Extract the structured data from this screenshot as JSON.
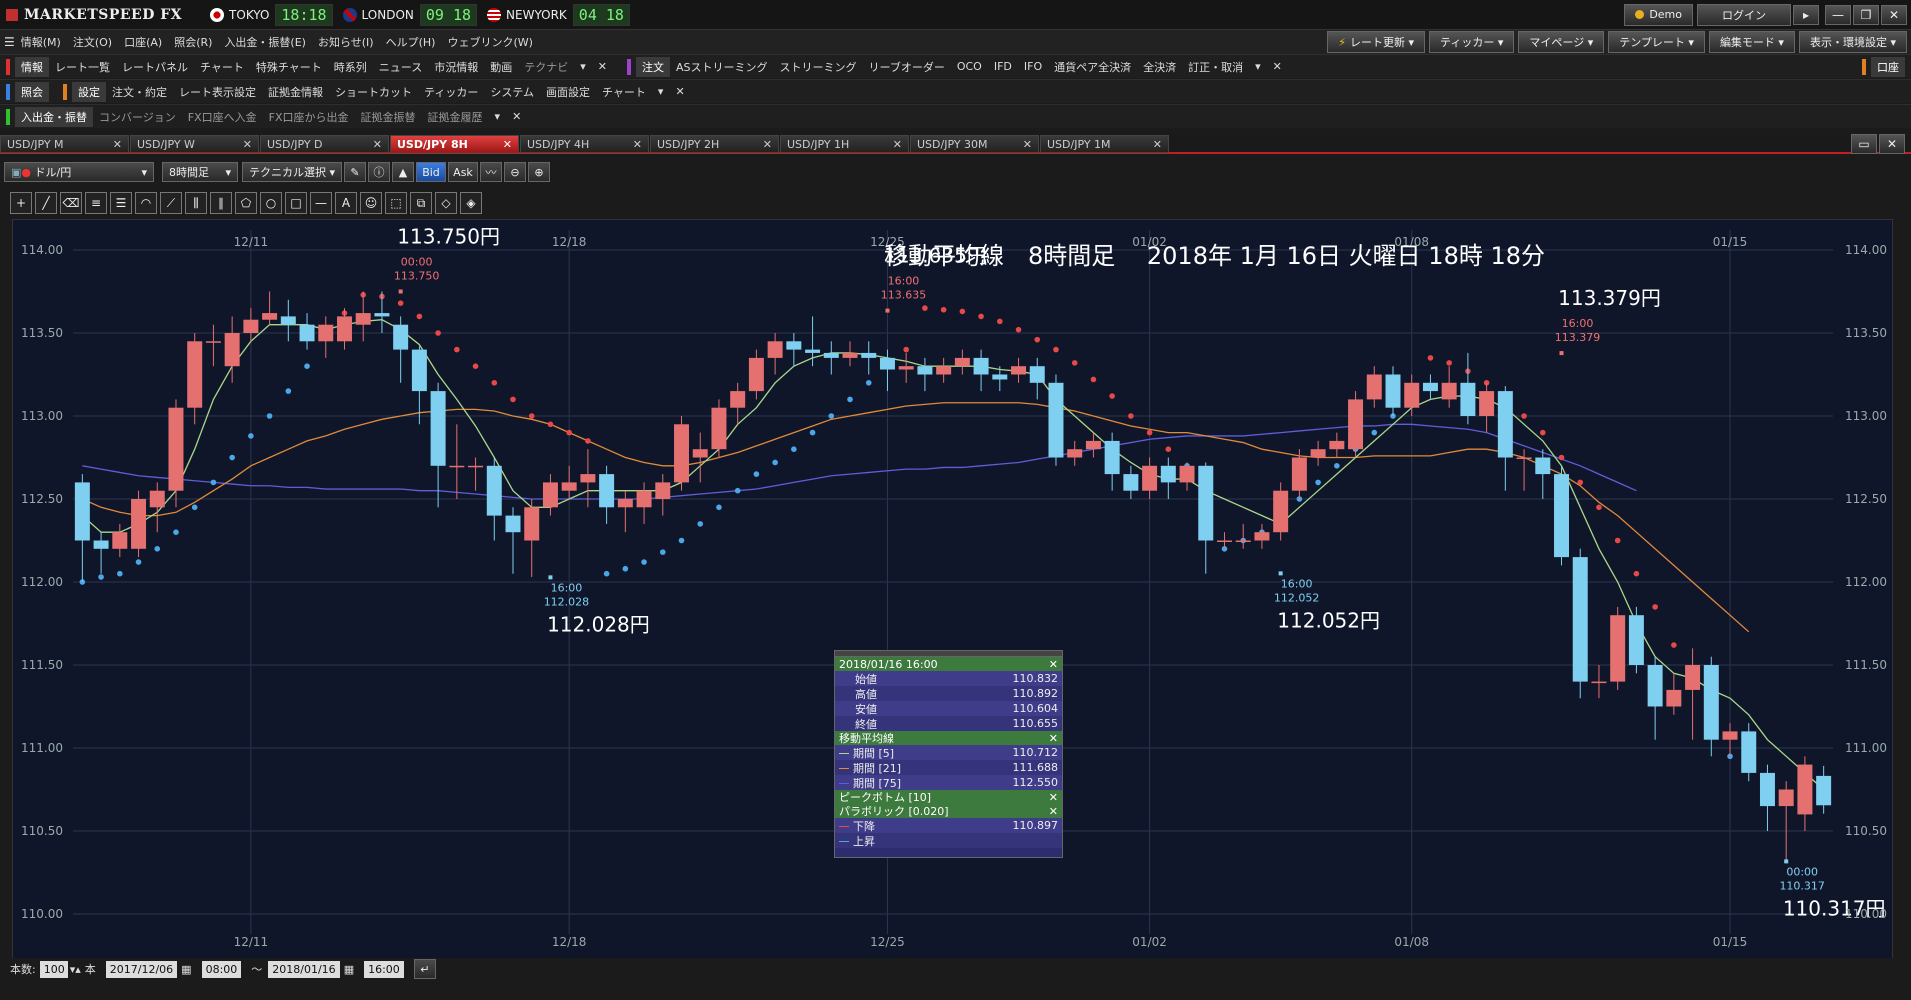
{
  "app": {
    "name": "MARKETSPEED FX",
    "cities": [
      {
        "name": "TOKYO",
        "time": "18:18",
        "flag": "jp"
      },
      {
        "name": "LONDON",
        "time": "09 18",
        "flag": "gb"
      },
      {
        "name": "NEWYORK",
        "time": "04 18",
        "flag": "us"
      }
    ],
    "demo": "Demo",
    "login": "ログイン"
  },
  "menu": [
    "情報(M)",
    "注文(O)",
    "口座(A)",
    "照会(R)",
    "入出金・振替(E)",
    "お知らせ(I)",
    "ヘルプ(H)",
    "ウェブリンク(W)"
  ],
  "menu_right": [
    "レート更新",
    "ティッカー",
    "マイページ",
    "テンプレート",
    "編集モード",
    "表示・環境設定"
  ],
  "toolbar1": {
    "info_header": "情報",
    "info_items": [
      "レート一覧",
      "レートパネル",
      "チャート",
      "特殊チャート",
      "時系列",
      "ニュース",
      "市況情報",
      "動画"
    ],
    "info_dim": "テクナビ",
    "order_header": "注文",
    "order_items": [
      "ASストリーミング",
      "ストリーミング",
      "リーブオーダー",
      "OCO",
      "IFD",
      "IFO",
      "通貨ペア全決済",
      "全決済",
      "訂正・取消"
    ],
    "account_btn": "口座"
  },
  "toolbar2": {
    "inquiry_header": "照会",
    "settings_header": "設定",
    "settings_items": [
      "注文・約定",
      "レート表示設定",
      "証拠金情報",
      "ショートカット",
      "ティッカー",
      "システム",
      "画面設定",
      "チャート"
    ]
  },
  "toolbar3": {
    "deposit_header": "入出金・振替",
    "deposit_items": [
      "コンバージョン",
      "FX口座へ入金",
      "FX口座から出金",
      "証拠金振替",
      "証拠金履歴"
    ]
  },
  "tabs": [
    {
      "label": "USD/JPY M",
      "active": false
    },
    {
      "label": "USD/JPY W",
      "active": false
    },
    {
      "label": "USD/JPY D",
      "active": false
    },
    {
      "label": "USD/JPY 8H",
      "active": true
    },
    {
      "label": "USD/JPY 4H",
      "active": false
    },
    {
      "label": "USD/JPY 2H",
      "active": false
    },
    {
      "label": "USD/JPY 1H",
      "active": false
    },
    {
      "label": "USD/JPY 30M",
      "active": false
    },
    {
      "label": "USD/JPY 1M",
      "active": false
    }
  ],
  "controls": {
    "pair": "ドル/円",
    "timeframe": "8時間足",
    "technical": "テクニカル選択",
    "bid": "Bid",
    "ask": "Ask"
  },
  "bottom": {
    "count_label": "本数:",
    "count": "100",
    "unit": "本",
    "from_date": "2017/12/06",
    "from_time": "08:00",
    "tilde": "〜",
    "to_date": "2018/01/16",
    "to_time": "16:00"
  },
  "chart_data": {
    "type": "candlestick",
    "title": "移動平均線　8時間足　 2018年 1月 16日 火曜日 18時 18分",
    "ylim": [
      110.0,
      114.0
    ],
    "y_ticks": [
      "114.00",
      "113.50",
      "113.00",
      "112.50",
      "112.00",
      "111.50",
      "111.00",
      "110.50",
      "110.00"
    ],
    "x_ticks": [
      "12/11",
      "12/18",
      "12/25",
      "01/02",
      "01/08",
      "01/15"
    ],
    "x_tick_index": [
      9,
      26,
      43,
      57,
      71,
      88
    ],
    "candles": [
      [
        112.6,
        112.25,
        112.65,
        112.0
      ],
      [
        112.25,
        112.2,
        112.3,
        112.05
      ],
      [
        112.2,
        112.3,
        112.35,
        112.15
      ],
      [
        112.2,
        112.5,
        112.55,
        112.15
      ],
      [
        112.45,
        112.55,
        112.6,
        112.3
      ],
      [
        112.55,
        113.05,
        113.1,
        112.45
      ],
      [
        113.05,
        113.45,
        113.5,
        112.95
      ],
      [
        113.45,
        113.45,
        113.55,
        113.3
      ],
      [
        113.3,
        113.5,
        113.6,
        113.2
      ],
      [
        113.5,
        113.58,
        113.65,
        113.45
      ],
      [
        113.58,
        113.62,
        113.75,
        113.55
      ],
      [
        113.6,
        113.55,
        113.7,
        113.45
      ],
      [
        113.55,
        113.45,
        113.62,
        113.4
      ],
      [
        113.45,
        113.55,
        113.6,
        113.35
      ],
      [
        113.45,
        113.6,
        113.65,
        113.4
      ],
      [
        113.55,
        113.62,
        113.75,
        113.45
      ],
      [
        113.62,
        113.6,
        113.75,
        113.5
      ],
      [
        113.55,
        113.4,
        113.6,
        113.2
      ],
      [
        113.4,
        113.15,
        113.42,
        112.95
      ],
      [
        113.15,
        112.7,
        113.2,
        112.45
      ],
      [
        112.7,
        112.7,
        112.95,
        112.5
      ],
      [
        112.7,
        112.7,
        112.75,
        112.55
      ],
      [
        112.7,
        112.4,
        112.75,
        112.25
      ],
      [
        112.4,
        112.3,
        112.45,
        112.05
      ],
      [
        112.25,
        112.45,
        112.5,
        112.03
      ],
      [
        112.45,
        112.6,
        112.65,
        112.4
      ],
      [
        112.55,
        112.6,
        112.7,
        112.5
      ],
      [
        112.6,
        112.65,
        112.8,
        112.45
      ],
      [
        112.65,
        112.45,
        112.7,
        112.35
      ],
      [
        112.45,
        112.5,
        112.55,
        112.3
      ],
      [
        112.45,
        112.55,
        112.6,
        112.35
      ],
      [
        112.5,
        112.6,
        112.65,
        112.4
      ],
      [
        112.6,
        112.95,
        113.0,
        112.55
      ],
      [
        112.75,
        112.8,
        112.9,
        112.6
      ],
      [
        112.8,
        113.05,
        113.1,
        112.75
      ],
      [
        113.05,
        113.15,
        113.2,
        112.95
      ],
      [
        113.15,
        113.35,
        113.4,
        113.1
      ],
      [
        113.35,
        113.45,
        113.5,
        113.25
      ],
      [
        113.45,
        113.4,
        113.5,
        113.3
      ],
      [
        113.4,
        113.38,
        113.6,
        113.3
      ],
      [
        113.38,
        113.35,
        113.45,
        113.25
      ],
      [
        113.35,
        113.38,
        113.45,
        113.3
      ],
      [
        113.38,
        113.35,
        113.45,
        113.25
      ],
      [
        113.35,
        113.28,
        113.4,
        113.15
      ],
      [
        113.28,
        113.3,
        113.38,
        113.2
      ],
      [
        113.3,
        113.25,
        113.35,
        113.15
      ],
      [
        113.25,
        113.3,
        113.35,
        113.2
      ],
      [
        113.3,
        113.35,
        113.4,
        113.25
      ],
      [
        113.35,
        113.25,
        113.4,
        113.15
      ],
      [
        113.25,
        113.22,
        113.3,
        113.15
      ],
      [
        113.25,
        113.3,
        113.35,
        113.2
      ],
      [
        113.3,
        113.2,
        113.35,
        113.1
      ],
      [
        113.2,
        112.75,
        113.25,
        112.7
      ],
      [
        112.75,
        112.8,
        112.85,
        112.7
      ],
      [
        112.8,
        112.85,
        112.9,
        112.75
      ],
      [
        112.85,
        112.65,
        112.9,
        112.55
      ],
      [
        112.65,
        112.55,
        112.7,
        112.5
      ],
      [
        112.55,
        112.7,
        112.75,
        112.5
      ],
      [
        112.7,
        112.6,
        112.75,
        112.5
      ],
      [
        112.6,
        112.7,
        112.72,
        112.55
      ],
      [
        112.7,
        112.25,
        112.72,
        112.05
      ],
      [
        112.25,
        112.25,
        112.3,
        112.2
      ],
      [
        112.25,
        112.25,
        112.35,
        112.2
      ],
      [
        112.25,
        112.3,
        112.35,
        112.2
      ],
      [
        112.3,
        112.55,
        112.6,
        112.25
      ],
      [
        112.55,
        112.75,
        112.8,
        112.5
      ],
      [
        112.75,
        112.8,
        112.85,
        112.7
      ],
      [
        112.8,
        112.85,
        112.9,
        112.75
      ],
      [
        112.8,
        113.1,
        113.15,
        112.75
      ],
      [
        113.1,
        113.25,
        113.3,
        113.05
      ],
      [
        113.25,
        113.05,
        113.3,
        113.0
      ],
      [
        113.05,
        113.2,
        113.25,
        113.0
      ],
      [
        113.2,
        113.15,
        113.25,
        113.1
      ],
      [
        113.1,
        113.2,
        113.3,
        113.05
      ],
      [
        113.2,
        113.0,
        113.38,
        112.95
      ],
      [
        113.0,
        113.15,
        113.2,
        112.9
      ],
      [
        113.15,
        112.75,
        113.18,
        112.55
      ],
      [
        112.75,
        112.75,
        112.8,
        112.55
      ],
      [
        112.75,
        112.65,
        112.8,
        112.5
      ],
      [
        112.65,
        112.15,
        112.7,
        112.1
      ],
      [
        112.15,
        111.4,
        112.2,
        111.3
      ],
      [
        111.4,
        111.4,
        111.5,
        111.3
      ],
      [
        111.4,
        111.8,
        111.85,
        111.35
      ],
      [
        111.8,
        111.5,
        111.85,
        111.45
      ],
      [
        111.5,
        111.25,
        111.55,
        111.05
      ],
      [
        111.25,
        111.35,
        111.45,
        111.2
      ],
      [
        111.35,
        111.5,
        111.6,
        111.05
      ],
      [
        111.5,
        111.05,
        111.55,
        110.95
      ],
      [
        111.05,
        111.1,
        111.15,
        110.95
      ],
      [
        111.1,
        110.85,
        111.15,
        110.8
      ],
      [
        110.85,
        110.65,
        110.9,
        110.5
      ],
      [
        110.65,
        110.75,
        110.8,
        110.317
      ],
      [
        110.6,
        110.9,
        110.95,
        110.5
      ],
      [
        110.832,
        110.655,
        110.892,
        110.604
      ]
    ],
    "ma5": [
      112.4,
      112.3,
      112.3,
      112.35,
      112.42,
      112.55,
      112.8,
      113.1,
      113.3,
      113.45,
      113.55,
      113.55,
      113.55,
      113.52,
      113.55,
      113.57,
      113.58,
      113.52,
      113.43,
      113.25,
      113.1,
      112.94,
      112.75,
      112.55,
      112.45,
      112.45,
      112.5,
      112.55,
      112.55,
      112.55,
      112.55,
      112.55,
      112.6,
      112.7,
      112.8,
      112.95,
      113.05,
      113.2,
      113.3,
      113.35,
      113.38,
      113.38,
      113.37,
      113.35,
      113.33,
      113.3,
      113.3,
      113.3,
      113.3,
      113.28,
      113.27,
      113.25,
      113.1,
      113.0,
      112.9,
      112.8,
      112.72,
      112.65,
      112.62,
      112.62,
      112.55,
      112.5,
      112.45,
      112.4,
      112.35,
      112.45,
      112.55,
      112.65,
      112.75,
      112.85,
      112.95,
      113.05,
      113.1,
      113.12,
      113.12,
      113.1,
      113.05,
      112.95,
      112.85,
      112.7,
      112.45,
      112.2,
      112.0,
      111.75,
      111.55,
      111.45,
      111.42,
      111.35,
      111.3,
      111.2,
      111.05,
      110.95,
      110.85,
      110.75
    ],
    "ma21": [
      112.5,
      112.45,
      112.42,
      112.4,
      112.4,
      112.42,
      112.48,
      112.55,
      112.62,
      112.7,
      112.75,
      112.8,
      112.85,
      112.88,
      112.92,
      112.95,
      112.98,
      113.0,
      113.02,
      113.03,
      113.04,
      113.04,
      113.03,
      113.0,
      112.98,
      112.95,
      112.9,
      112.85,
      112.8,
      112.75,
      112.72,
      112.7,
      112.7,
      112.72,
      112.75,
      112.78,
      112.82,
      112.86,
      112.9,
      112.94,
      112.98,
      113.0,
      113.02,
      113.04,
      113.06,
      113.07,
      113.08,
      113.08,
      113.08,
      113.08,
      113.08,
      113.07,
      113.05,
      113.03,
      113.0,
      112.97,
      112.94,
      112.92,
      112.9,
      112.9,
      112.88,
      112.86,
      112.84,
      112.8,
      112.78,
      112.76,
      112.75,
      112.75,
      112.75,
      112.76,
      112.76,
      112.76,
      112.76,
      112.78,
      112.8,
      112.8,
      112.78,
      112.75,
      112.7,
      112.65,
      112.58,
      112.48,
      112.4,
      112.3,
      112.2,
      112.1,
      112.0,
      111.9,
      111.8,
      111.7
    ],
    "ma75": [
      112.7,
      112.68,
      112.66,
      112.64,
      112.63,
      112.62,
      112.61,
      112.6,
      112.59,
      112.58,
      112.58,
      112.57,
      112.57,
      112.56,
      112.56,
      112.56,
      112.56,
      112.56,
      112.55,
      112.55,
      112.54,
      112.53,
      112.52,
      112.51,
      112.5,
      112.5,
      112.5,
      112.5,
      112.5,
      112.5,
      112.5,
      112.51,
      112.52,
      112.53,
      112.54,
      112.55,
      112.56,
      112.58,
      112.6,
      112.62,
      112.64,
      112.65,
      112.66,
      112.67,
      112.68,
      112.68,
      112.69,
      112.69,
      112.7,
      112.71,
      112.72,
      112.74,
      112.76,
      112.78,
      112.8,
      112.82,
      112.84,
      112.86,
      112.87,
      112.88,
      112.88,
      112.88,
      112.88,
      112.89,
      112.9,
      112.91,
      112.92,
      112.93,
      112.94,
      112.94,
      112.95,
      112.95,
      112.94,
      112.93,
      112.92,
      112.9,
      112.86,
      112.82,
      112.78,
      112.74,
      112.7,
      112.65,
      112.6,
      112.55
    ],
    "sar": [
      112.0,
      112.03,
      112.05,
      112.12,
      112.2,
      112.3,
      112.45,
      112.6,
      112.75,
      112.88,
      113.0,
      113.15,
      113.3,
      113.5,
      113.62,
      113.73,
      113.72,
      113.68,
      113.6,
      113.5,
      113.4,
      113.3,
      113.2,
      113.1,
      113.0,
      112.95,
      112.9,
      112.85,
      112.05,
      112.08,
      112.12,
      112.18,
      112.25,
      112.35,
      112.45,
      112.55,
      112.65,
      112.72,
      112.8,
      112.9,
      113.0,
      113.1,
      113.2,
      113.3,
      113.4,
      113.65,
      113.64,
      113.63,
      113.6,
      113.57,
      113.52,
      113.46,
      113.4,
      113.32,
      113.22,
      113.12,
      113.0,
      112.9,
      112.8,
      112.7,
      112.6,
      112.2,
      112.25,
      112.3,
      112.4,
      112.5,
      112.6,
      112.7,
      112.8,
      112.9,
      113.0,
      113.08,
      113.35,
      113.32,
      113.27,
      113.2,
      113.1,
      113.0,
      112.9,
      112.75,
      112.6,
      112.45,
      112.25,
      112.05,
      111.85,
      111.62,
      111.4,
      111.2,
      110.95
    ],
    "ann": [
      {
        "i": 17,
        "price": 113.75,
        "time": "00:00",
        "val": "113.750",
        "big": "113.750円",
        "pos": "top"
      },
      {
        "i": 43,
        "price": 113.635,
        "time": "16:00",
        "val": "113.635",
        "big": "113.635円",
        "pos": "top"
      },
      {
        "i": 25,
        "price": 112.028,
        "time": "16:00",
        "val": "112.028",
        "big": "112.028円",
        "pos": "bottom"
      },
      {
        "i": 64,
        "price": 112.052,
        "time": "16:00",
        "val": "112.052",
        "big": "112.052円",
        "pos": "bottom"
      },
      {
        "i": 79,
        "price": 113.379,
        "time": "16:00",
        "val": "113.379",
        "big": "113.379円",
        "pos": "top"
      },
      {
        "i": 91,
        "price": 110.317,
        "time": "00:00",
        "val": "110.317",
        "big": "110.317円",
        "pos": "bottom"
      }
    ],
    "colors": {
      "up": "#e57070",
      "down": "#7ecff0",
      "ma5": "#a8d88a",
      "ma21": "#e08a3a",
      "ma75": "#5e5ed8",
      "sar_down": "#e84848",
      "sar_up": "#4aa8e8"
    }
  },
  "popup": {
    "date": "2018/01/16 16:00",
    "ohlc": [
      {
        "label": "始値",
        "value": "110.832"
      },
      {
        "label": "高値",
        "value": "110.892"
      },
      {
        "label": "安値",
        "value": "110.604"
      },
      {
        "label": "終値",
        "value": "110.655"
      }
    ],
    "ma_header": "移動平均線",
    "ma": [
      {
        "label": "期間 [5]",
        "value": "110.712",
        "color": "#a8d88a"
      },
      {
        "label": "期間 [21]",
        "value": "111.688",
        "color": "#e08a3a"
      },
      {
        "label": "期間 [75]",
        "value": "112.550",
        "color": "#5e5ed8"
      }
    ],
    "peak_header": "ピークボトム [10]",
    "sar_header": "パラボリック [0.020]",
    "sar": [
      {
        "label": "下降",
        "value": "110.897",
        "color": "#e84848"
      },
      {
        "label": "上昇",
        "value": "",
        "color": "#4aa8e8"
      }
    ]
  }
}
